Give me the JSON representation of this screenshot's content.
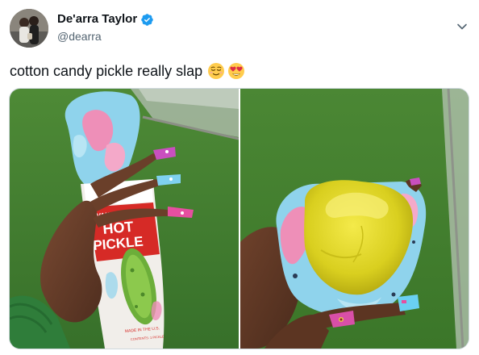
{
  "author": {
    "display_name": "De'arra Taylor",
    "handle": "@dearra",
    "verified": true,
    "avatar_icon": "avatar-photo"
  },
  "tweet": {
    "text": "cotton candy pickle really slap",
    "emojis": [
      "relieved-face-emoji",
      "heart-eyes-emoji"
    ]
  },
  "media": {
    "photos": [
      {
        "id": "left",
        "packaging_text": [
          "VAN HOLTEN'S",
          "HOT",
          "PICKLE",
          "MADE IN THE U.S.",
          "CONTENTS: 1 PICKLE"
        ]
      },
      {
        "id": "right"
      }
    ]
  },
  "colors": {
    "verified_blue": "#1d9bf0",
    "handle_gray": "#536471",
    "turf_green": "#3f7a2e",
    "cotton_candy_blue": "#8fd3ec",
    "cotton_candy_pink": "#ee8fb8",
    "pickle_yellow": "#e6d92a"
  }
}
